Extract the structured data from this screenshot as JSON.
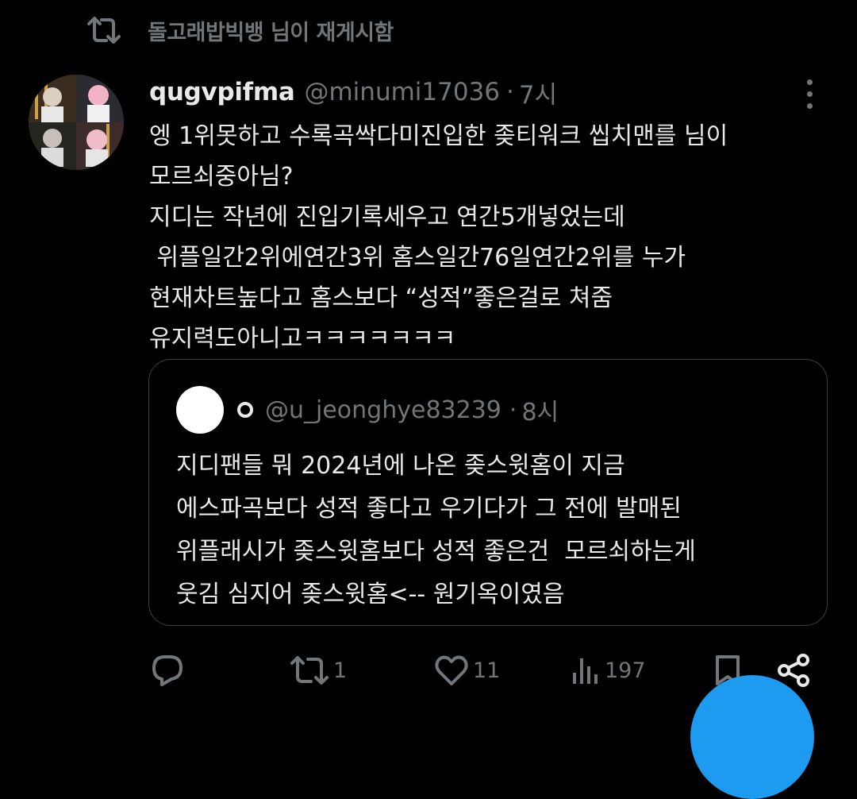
{
  "repost": {
    "text": "돌고래밥빅뱅 님이 재게시함",
    "icon": "repost-icon"
  },
  "tweet": {
    "display_name": "qugvpifma",
    "handle": "@minumi17036",
    "separator": "·",
    "time": "7시",
    "body_lines": [
      "엥 1위못하고 수록곡싹다미진입한 좆티워크 씹치맨를 님이",
      "모르쇠중아님?",
      "지디는 작년에 진입기록세우고 연간5개넣었는데",
      " 위플일간2위에연간3위 홈스일간76일연간2위를 누가",
      "현재차트높다고 홈스보다 “성적”좋은걸로 쳐줌",
      "유지력도아니고ㅋㅋㅋㅋㅋㅋㅋ"
    ]
  },
  "quote": {
    "name_icon": "circle-icon",
    "handle": "@u_jeonghye83239",
    "separator": "·",
    "time": "8시",
    "body_lines": [
      "지디팬들 뭐 2024년에 나온 좆스윗홈이 지금",
      "에스파곡보다 성적 좋다고 우기다가 그 전에 발매된",
      "위플래시가 좆스윗홈보다 성적 좋은건  모르쇠하는게",
      "웃김 심지어 좆스윗홈<-- 원기옥이였음"
    ]
  },
  "actions": {
    "reply": {
      "icon": "reply-icon",
      "count": ""
    },
    "repost": {
      "icon": "repost-icon",
      "count": "1"
    },
    "like": {
      "icon": "heart-icon",
      "count": "11"
    },
    "views": {
      "icon": "views-icon",
      "count": "197"
    },
    "bookmark": {
      "icon": "bookmark-icon"
    },
    "share": {
      "icon": "share-icon"
    }
  },
  "colors": {
    "background": "#000000",
    "text": "#e7e9ea",
    "muted": "#71767b",
    "border": "#3a3f44",
    "accent": "#1d9bf0"
  }
}
